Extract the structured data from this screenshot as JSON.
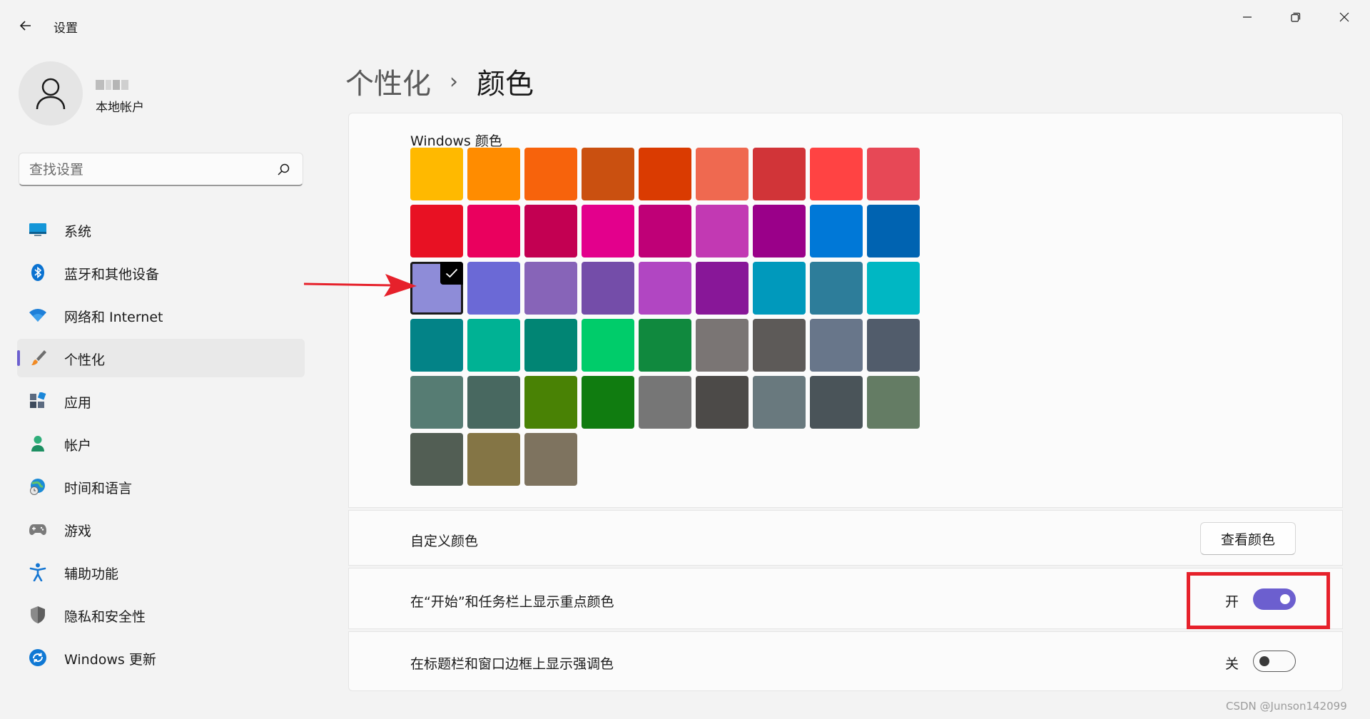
{
  "app": {
    "title": "设置"
  },
  "profile": {
    "account_type": "本地帐户"
  },
  "search": {
    "placeholder": "查找设置"
  },
  "sidebar": {
    "items": [
      {
        "label": "系统",
        "icon": "system-icon"
      },
      {
        "label": "蓝牙和其他设备",
        "icon": "bluetooth-icon"
      },
      {
        "label": "网络和 Internet",
        "icon": "wifi-icon"
      },
      {
        "label": "个性化",
        "icon": "brush-icon",
        "active": true
      },
      {
        "label": "应用",
        "icon": "apps-icon"
      },
      {
        "label": "帐户",
        "icon": "account-icon"
      },
      {
        "label": "时间和语言",
        "icon": "globe-clock-icon"
      },
      {
        "label": "游戏",
        "icon": "gamepad-icon"
      },
      {
        "label": "辅助功能",
        "icon": "accessibility-icon"
      },
      {
        "label": "隐私和安全性",
        "icon": "shield-icon"
      },
      {
        "label": "Windows 更新",
        "icon": "update-icon"
      }
    ]
  },
  "breadcrumb": {
    "parent": "个性化",
    "separator": "›",
    "current": "颜色"
  },
  "colors": {
    "section_label": "Windows 颜色",
    "selected_index": 18,
    "swatches": [
      "#FFB900",
      "#FF8C00",
      "#F7630C",
      "#CA5010",
      "#DA3B01",
      "#EF6950",
      "#D13438",
      "#FF4343",
      "#E74856",
      "#E81123",
      "#EA005E",
      "#C30052",
      "#E3008C",
      "#BF0077",
      "#C239B3",
      "#9A0089",
      "#0078D7",
      "#0063B1",
      "#8E8CD8",
      "#6B69D6",
      "#8764B8",
      "#744DA9",
      "#B146C2",
      "#881798",
      "#0099BC",
      "#2D7D9A",
      "#00B7C3",
      "#038387",
      "#00B294",
      "#018574",
      "#00CC6A",
      "#10893E",
      "#7A7574",
      "#5D5A58",
      "#68768A",
      "#515C6B",
      "#567C73",
      "#486860",
      "#498205",
      "#107C10",
      "#767676",
      "#4C4A48",
      "#69797E",
      "#4A5459",
      "#647C64",
      "#525E54",
      "#847545",
      "#7E735F"
    ]
  },
  "custom_color": {
    "label": "自定义颜色",
    "button": "查看颜色"
  },
  "start_taskbar_accent": {
    "label": "在“开始”和任务栏上显示重点颜色",
    "state": "开",
    "on": true
  },
  "titlebar_accent": {
    "label": "在标题栏和窗口边框上显示强调色",
    "state": "关",
    "on": false
  },
  "accent_color": "#6C5FCF",
  "watermark": "CSDN @Junson142099"
}
